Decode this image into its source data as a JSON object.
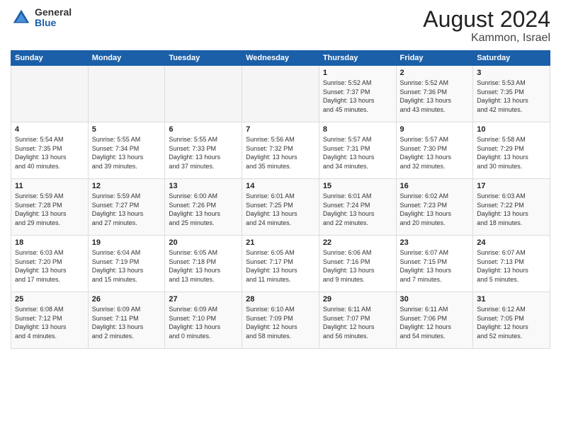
{
  "logo": {
    "general": "General",
    "blue": "Blue"
  },
  "header": {
    "title": "August 2024",
    "subtitle": "Kammon, Israel"
  },
  "weekdays": [
    "Sunday",
    "Monday",
    "Tuesday",
    "Wednesday",
    "Thursday",
    "Friday",
    "Saturday"
  ],
  "weeks": [
    [
      {
        "day": "",
        "content": ""
      },
      {
        "day": "",
        "content": ""
      },
      {
        "day": "",
        "content": ""
      },
      {
        "day": "",
        "content": ""
      },
      {
        "day": "1",
        "content": "Sunrise: 5:52 AM\nSunset: 7:37 PM\nDaylight: 13 hours\nand 45 minutes."
      },
      {
        "day": "2",
        "content": "Sunrise: 5:52 AM\nSunset: 7:36 PM\nDaylight: 13 hours\nand 43 minutes."
      },
      {
        "day": "3",
        "content": "Sunrise: 5:53 AM\nSunset: 7:35 PM\nDaylight: 13 hours\nand 42 minutes."
      }
    ],
    [
      {
        "day": "4",
        "content": "Sunrise: 5:54 AM\nSunset: 7:35 PM\nDaylight: 13 hours\nand 40 minutes."
      },
      {
        "day": "5",
        "content": "Sunrise: 5:55 AM\nSunset: 7:34 PM\nDaylight: 13 hours\nand 39 minutes."
      },
      {
        "day": "6",
        "content": "Sunrise: 5:55 AM\nSunset: 7:33 PM\nDaylight: 13 hours\nand 37 minutes."
      },
      {
        "day": "7",
        "content": "Sunrise: 5:56 AM\nSunset: 7:32 PM\nDaylight: 13 hours\nand 35 minutes."
      },
      {
        "day": "8",
        "content": "Sunrise: 5:57 AM\nSunset: 7:31 PM\nDaylight: 13 hours\nand 34 minutes."
      },
      {
        "day": "9",
        "content": "Sunrise: 5:57 AM\nSunset: 7:30 PM\nDaylight: 13 hours\nand 32 minutes."
      },
      {
        "day": "10",
        "content": "Sunrise: 5:58 AM\nSunset: 7:29 PM\nDaylight: 13 hours\nand 30 minutes."
      }
    ],
    [
      {
        "day": "11",
        "content": "Sunrise: 5:59 AM\nSunset: 7:28 PM\nDaylight: 13 hours\nand 29 minutes."
      },
      {
        "day": "12",
        "content": "Sunrise: 5:59 AM\nSunset: 7:27 PM\nDaylight: 13 hours\nand 27 minutes."
      },
      {
        "day": "13",
        "content": "Sunrise: 6:00 AM\nSunset: 7:26 PM\nDaylight: 13 hours\nand 25 minutes."
      },
      {
        "day": "14",
        "content": "Sunrise: 6:01 AM\nSunset: 7:25 PM\nDaylight: 13 hours\nand 24 minutes."
      },
      {
        "day": "15",
        "content": "Sunrise: 6:01 AM\nSunset: 7:24 PM\nDaylight: 13 hours\nand 22 minutes."
      },
      {
        "day": "16",
        "content": "Sunrise: 6:02 AM\nSunset: 7:23 PM\nDaylight: 13 hours\nand 20 minutes."
      },
      {
        "day": "17",
        "content": "Sunrise: 6:03 AM\nSunset: 7:22 PM\nDaylight: 13 hours\nand 18 minutes."
      }
    ],
    [
      {
        "day": "18",
        "content": "Sunrise: 6:03 AM\nSunset: 7:20 PM\nDaylight: 13 hours\nand 17 minutes."
      },
      {
        "day": "19",
        "content": "Sunrise: 6:04 AM\nSunset: 7:19 PM\nDaylight: 13 hours\nand 15 minutes."
      },
      {
        "day": "20",
        "content": "Sunrise: 6:05 AM\nSunset: 7:18 PM\nDaylight: 13 hours\nand 13 minutes."
      },
      {
        "day": "21",
        "content": "Sunrise: 6:05 AM\nSunset: 7:17 PM\nDaylight: 13 hours\nand 11 minutes."
      },
      {
        "day": "22",
        "content": "Sunrise: 6:06 AM\nSunset: 7:16 PM\nDaylight: 13 hours\nand 9 minutes."
      },
      {
        "day": "23",
        "content": "Sunrise: 6:07 AM\nSunset: 7:15 PM\nDaylight: 13 hours\nand 7 minutes."
      },
      {
        "day": "24",
        "content": "Sunrise: 6:07 AM\nSunset: 7:13 PM\nDaylight: 13 hours\nand 5 minutes."
      }
    ],
    [
      {
        "day": "25",
        "content": "Sunrise: 6:08 AM\nSunset: 7:12 PM\nDaylight: 13 hours\nand 4 minutes."
      },
      {
        "day": "26",
        "content": "Sunrise: 6:09 AM\nSunset: 7:11 PM\nDaylight: 13 hours\nand 2 minutes."
      },
      {
        "day": "27",
        "content": "Sunrise: 6:09 AM\nSunset: 7:10 PM\nDaylight: 13 hours\nand 0 minutes."
      },
      {
        "day": "28",
        "content": "Sunrise: 6:10 AM\nSunset: 7:09 PM\nDaylight: 12 hours\nand 58 minutes."
      },
      {
        "day": "29",
        "content": "Sunrise: 6:11 AM\nSunset: 7:07 PM\nDaylight: 12 hours\nand 56 minutes."
      },
      {
        "day": "30",
        "content": "Sunrise: 6:11 AM\nSunset: 7:06 PM\nDaylight: 12 hours\nand 54 minutes."
      },
      {
        "day": "31",
        "content": "Sunrise: 6:12 AM\nSunset: 7:05 PM\nDaylight: 12 hours\nand 52 minutes."
      }
    ]
  ]
}
